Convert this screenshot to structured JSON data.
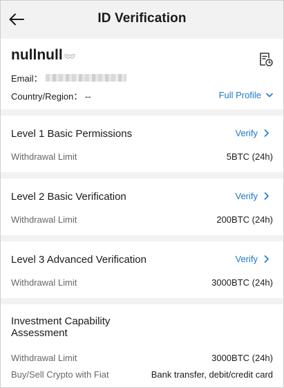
{
  "header": {
    "title": "ID Verification",
    "back_icon": "arrow-left-icon"
  },
  "profile": {
    "username": "nullnull",
    "email_label": "Email：",
    "country_label": "Country/Region：",
    "country_value": "--",
    "full_profile_label": "Full Profile",
    "icons": [
      "mask-icon",
      "document-clock-icon",
      "chevron-down-icon"
    ]
  },
  "levels": [
    {
      "title": "Level 1 Basic Permissions",
      "verify_label": "Verify",
      "limit_label": "Withdrawal Limit",
      "limit_value": "5BTC (24h)"
    },
    {
      "title": "Level 2 Basic Verification",
      "verify_label": "Verify",
      "limit_label": "Withdrawal Limit",
      "limit_value": "200BTC (24h)"
    },
    {
      "title": "Level 3 Advanced Verification",
      "verify_label": "Verify",
      "limit_label": "Withdrawal Limit",
      "limit_value": "3000BTC (24h)"
    }
  ],
  "investment": {
    "title": "Investment Capability Assessment",
    "rows": [
      {
        "label": "Withdrawal Limit",
        "value": "3000BTC (24h)"
      },
      {
        "label": "Buy/Sell Crypto with Fiat",
        "value": "Bank transfer, debit/credit card"
      }
    ]
  },
  "colors": {
    "accent": "#1e78c8",
    "background": "#f2f2f2",
    "card": "#ffffff",
    "muted_text": "#666666"
  }
}
